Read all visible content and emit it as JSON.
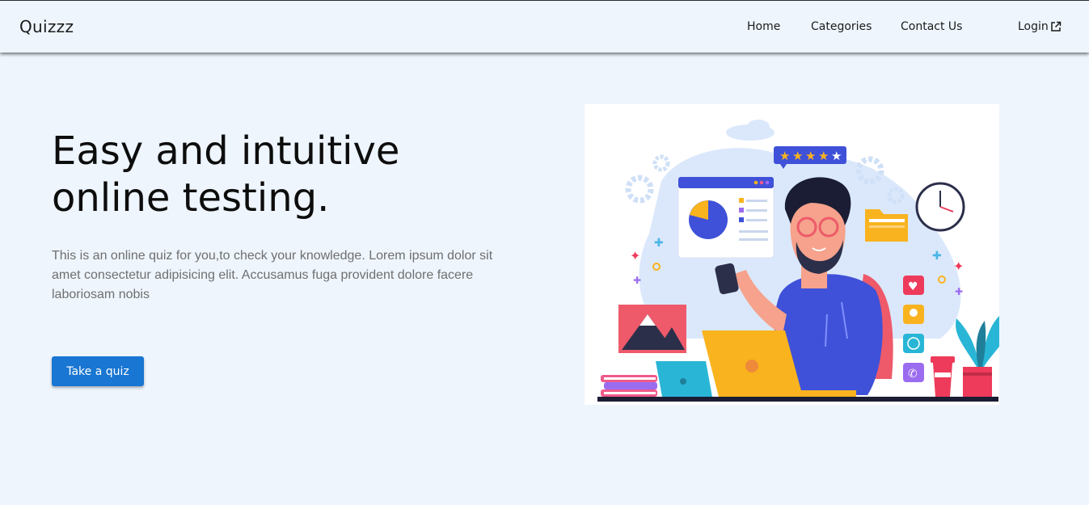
{
  "navbar": {
    "brand": "Quizzz",
    "links": [
      "Home",
      "Categories",
      "Contact Us"
    ],
    "login_label": "Login",
    "login_icon": "external-link-icon"
  },
  "hero": {
    "title_line1": "Easy and intuitive",
    "title_line2": "online testing.",
    "description": "This is an online quiz for you,to check your knowledge. Lorem ipsum dolor sit amet consectetur adipisicing elit. Accusamus fuga provident dolore facere laboriosam nobis",
    "cta_label": "Take a quiz",
    "illustration_rating_stars": 5
  },
  "colors": {
    "background": "#eef5fd",
    "primary_button": "#1976d2",
    "text_dark": "#0d0d0d",
    "text_muted": "#6f6f6f",
    "accent_blue": "#3f51d8",
    "accent_yellow": "#f9b31e"
  }
}
